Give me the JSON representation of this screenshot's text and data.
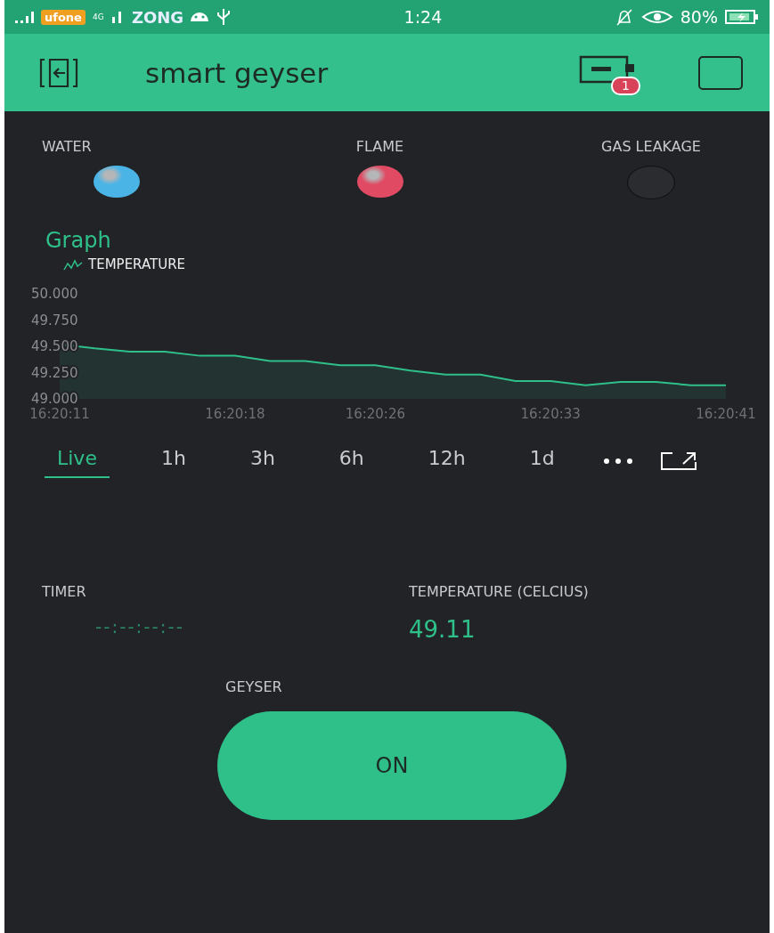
{
  "status_bar": {
    "carrier_1": "ufone",
    "network": "4G",
    "carrier_2": "ZONG",
    "time": "1:24",
    "battery": "80%"
  },
  "header": {
    "title": "smart geyser",
    "badge": "1"
  },
  "leds": [
    {
      "label": "WATER",
      "on": true,
      "color": "#4ab4e6"
    },
    {
      "label": "FLAME",
      "on": true,
      "color": "#e04a63"
    },
    {
      "label": "GAS LEAKAGE",
      "on": false,
      "color": "#2a2c30"
    }
  ],
  "graph": {
    "title": "Graph",
    "chart_data": {
      "type": "area",
      "series": [
        {
          "name": "TEMPERATURE",
          "color": "#2fc08a",
          "values": [
            49.52,
            49.48,
            49.45,
            49.45,
            49.41,
            49.41,
            49.36,
            49.36,
            49.32,
            49.32,
            49.27,
            49.23,
            49.23,
            49.17,
            49.17,
            49.13,
            49.16,
            49.16,
            49.13,
            49.13
          ]
        }
      ],
      "categories": [
        "16:20:11",
        null,
        null,
        null,
        null,
        "16:20:18",
        null,
        null,
        null,
        "16:20:26",
        null,
        null,
        null,
        null,
        "16:20:33",
        null,
        null,
        null,
        null,
        "16:20:41"
      ],
      "ylim": [
        49,
        50
      ],
      "yticks": [
        {
          "value": 50,
          "label": "50.000"
        },
        {
          "value": 49.75,
          "label": "49.750"
        },
        {
          "value": 49.5,
          "label": "49.500"
        },
        {
          "value": 49.25,
          "label": "49.250"
        },
        {
          "value": 49,
          "label": "49.000"
        }
      ]
    },
    "periods": [
      {
        "label": "Live",
        "selected": true
      },
      {
        "label": "1h",
        "selected": false
      },
      {
        "label": "3h",
        "selected": false
      },
      {
        "label": "6h",
        "selected": false
      },
      {
        "label": "12h",
        "selected": false
      },
      {
        "label": "1d",
        "selected": false
      }
    ]
  },
  "timer": {
    "label": "TIMER",
    "value": "--:--:--:--"
  },
  "temperature": {
    "label": "TEMPERATURE (CELCIUS)",
    "value": "49.11"
  },
  "geyser": {
    "label": "GEYSER",
    "button": "ON"
  }
}
